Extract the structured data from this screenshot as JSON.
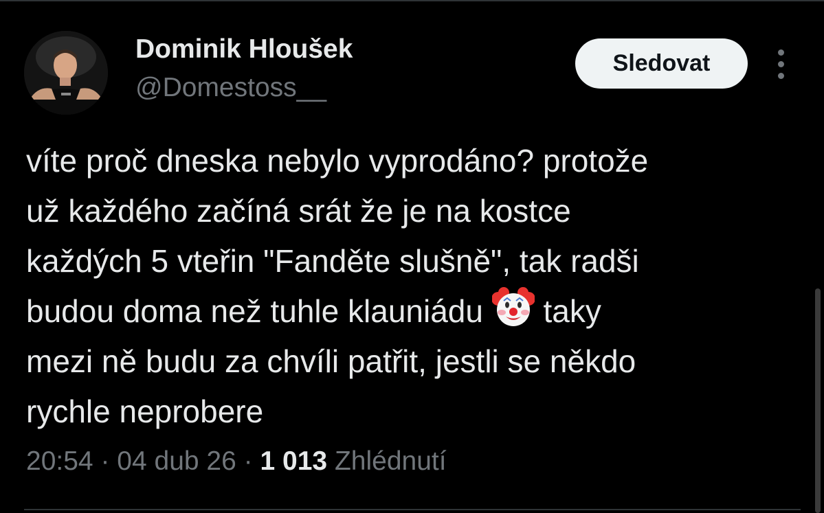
{
  "author": {
    "display_name": "Dominik Hloušek",
    "handle": "@Domestoss__",
    "avatar_icon": "profile-photo"
  },
  "actions": {
    "follow_label": "Sledovat",
    "more_icon": "vertical-ellipsis-icon"
  },
  "tweet": {
    "lines": [
      "víte proč dneska nebylo vyprodáno? protože",
      "už každého začíná srát že je na kostce",
      "každých 5 vteřin \"Fanděte slušně\", tak radši",
      "budou doma než tuhle klauniádu",
      "taky",
      "mezi ně budu za chvíli patřit, jestli se někdo",
      "rychle neprobere"
    ],
    "emoji": "clown-face-icon"
  },
  "meta": {
    "time": "20:54",
    "date": "04 dub 26",
    "separator": "·",
    "views_count": "1 013",
    "views_label": "Zhlédnutí"
  },
  "colors": {
    "background": "#000000",
    "primary_text": "#e7e9ea",
    "secondary_text": "#71767b",
    "button_bg": "#eff3f4",
    "button_text": "#0f1419",
    "divider": "#2f3336"
  }
}
